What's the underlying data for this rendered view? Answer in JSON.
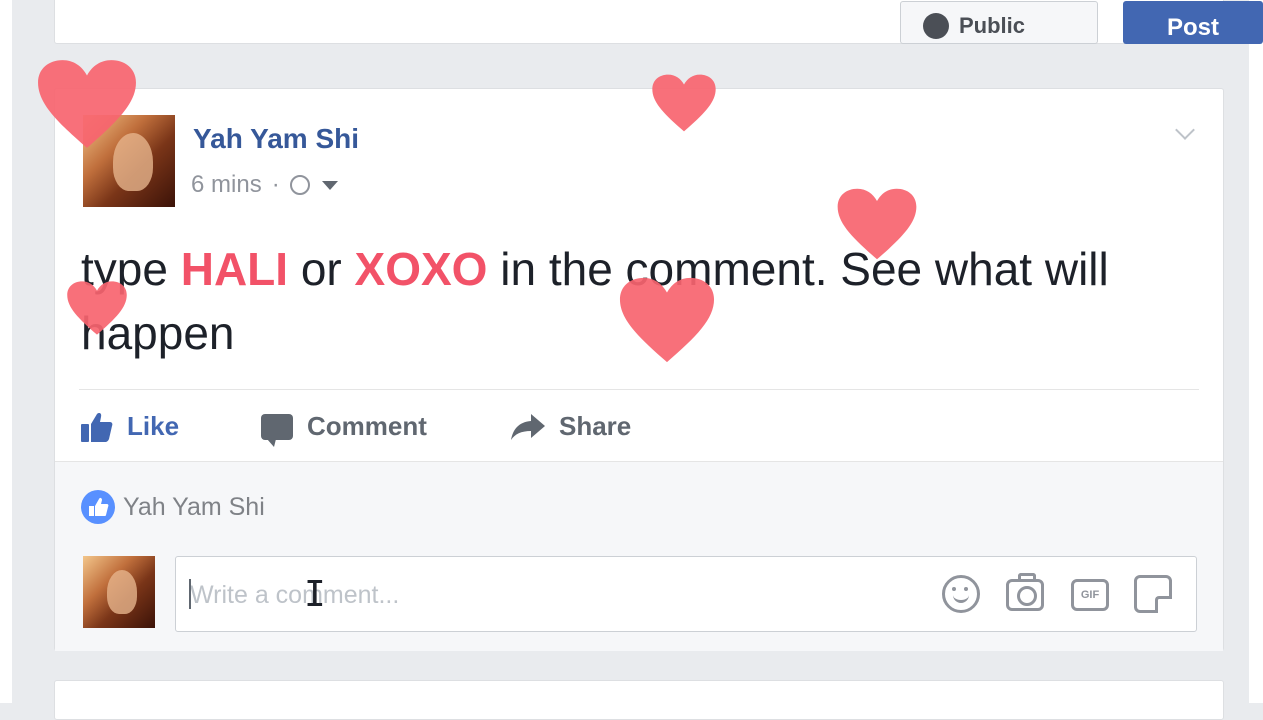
{
  "composer": {
    "privacy_label": "Public",
    "post_label": "Post"
  },
  "post": {
    "author": "Yah Yam Shi",
    "timestamp": "6 mins",
    "separator": "·",
    "text": {
      "part1": "type ",
      "highlight1": "HALI",
      "part2": " or ",
      "highlight2": "XOXO",
      "part3": " in the comment. See what will happen"
    },
    "actions": {
      "like": "Like",
      "comment": "Comment",
      "share": "Share"
    },
    "liked_by": "Yah Yam Shi",
    "comment_placeholder": "Write a comment..."
  },
  "colors": {
    "highlight": "#f25268",
    "heart": "#f7646f",
    "link_blue": "#365899",
    "like_blue": "#4267b2"
  },
  "icons": [
    "globe-icon",
    "chevron-down-icon",
    "like-icon",
    "comment-icon",
    "share-icon",
    "like-badge-icon",
    "emoji-icon",
    "camera-icon",
    "gif-icon",
    "sticker-icon",
    "heart-icon"
  ]
}
